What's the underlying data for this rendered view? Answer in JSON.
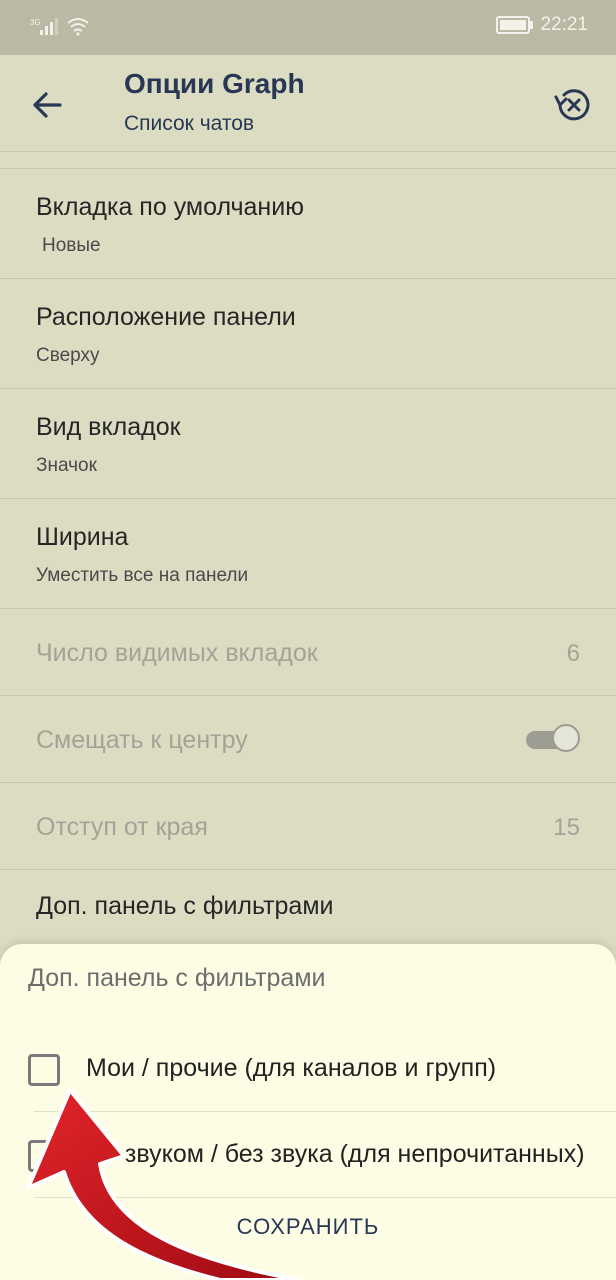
{
  "status": {
    "network": "3G",
    "time": "22:21"
  },
  "header": {
    "title": "Опции Graph",
    "subtitle": "Список чатов"
  },
  "settings": [
    {
      "label": "Вкладка по умолчанию",
      "value": "Новые"
    },
    {
      "label": "Расположение панели",
      "value": "Сверху"
    },
    {
      "label": "Вид вкладок",
      "value": "Значок"
    },
    {
      "label": "Ширина",
      "value": "Уместить все на панели"
    },
    {
      "label": "Число видимых вкладок",
      "number": "6",
      "enabled": false
    },
    {
      "label": "Смещать к центру",
      "toggle": true,
      "enabled": false
    },
    {
      "label": "Отступ от края",
      "number": "15",
      "enabled": false
    },
    {
      "label": "Доп. панель с фильтрами"
    }
  ],
  "dialog": {
    "title": "Доп. панель с фильтрами",
    "options": [
      {
        "label": "Мои / прочие (для каналов и групп)",
        "checked": false
      },
      {
        "label": "Со звуком / без звука (для непрочитанных)",
        "checked": false
      }
    ],
    "save_label": "СОХРАНИТЬ"
  },
  "colors": {
    "accent": "#283754",
    "arrow": "#c8141c",
    "sheet_bg": "#fdfde6",
    "page_bg": "#dcdcc2"
  }
}
